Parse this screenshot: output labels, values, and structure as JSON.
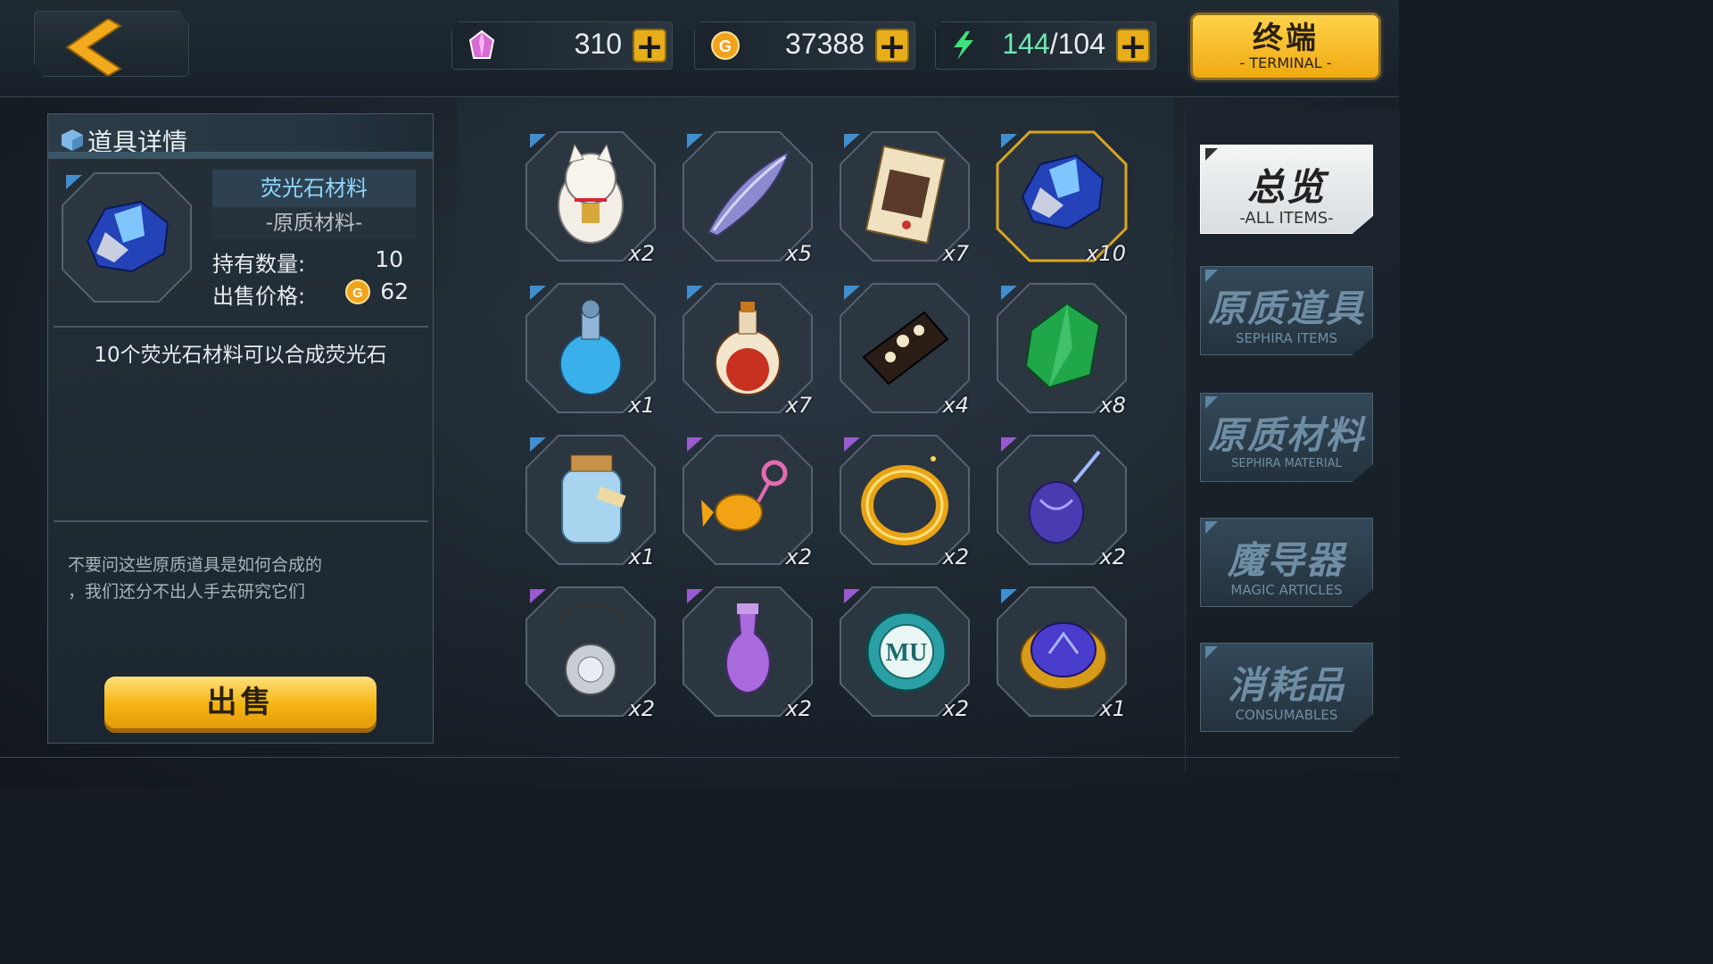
{
  "resources": {
    "crystal": {
      "value": "310"
    },
    "gold": {
      "value": "37388"
    },
    "energy": {
      "current": "144",
      "max": "/104"
    }
  },
  "terminal": {
    "zh": "终端",
    "en": "- TERMINAL -"
  },
  "detail": {
    "title": "道具详情",
    "item_name": "荧光石材料",
    "item_type": "-原质材料-",
    "owned_label": "持有数量:",
    "owned_value": "10",
    "price_label": "出售价格:",
    "price_value": "62",
    "description": "10个荧光石材料可以合成荧光石",
    "flavor": "不要问这些原质道具是如何合成的\n，我们还分不出人手去研究它们",
    "sell_label": "出售"
  },
  "items": [
    {
      "icon": "lucky-cat-icon",
      "qty": "x2",
      "rarity": "blue"
    },
    {
      "icon": "feather-blade-icon",
      "qty": "x5",
      "rarity": "blue"
    },
    {
      "icon": "portrait-card-icon",
      "qty": "x7",
      "rarity": "blue"
    },
    {
      "icon": "fluorite-ore-icon",
      "qty": "x10",
      "rarity": "blue",
      "selected": true
    },
    {
      "icon": "blue-potion-icon",
      "qty": "x1",
      "rarity": "blue"
    },
    {
      "icon": "red-potion-icon",
      "qty": "x7",
      "rarity": "blue"
    },
    {
      "icon": "flower-comb-icon",
      "qty": "x4",
      "rarity": "blue"
    },
    {
      "icon": "green-crystal-icon",
      "qty": "x8",
      "rarity": "blue"
    },
    {
      "icon": "glass-jar-icon",
      "qty": "x1",
      "rarity": "blue"
    },
    {
      "icon": "goldfish-charm-icon",
      "qty": "x2",
      "rarity": "purple"
    },
    {
      "icon": "gold-ring-icon",
      "qty": "x2",
      "rarity": "purple"
    },
    {
      "icon": "purple-pendant-icon",
      "qty": "x2",
      "rarity": "purple"
    },
    {
      "icon": "silver-locket-icon",
      "qty": "x2",
      "rarity": "purple"
    },
    {
      "icon": "purple-vase-icon",
      "qty": "x2",
      "rarity": "purple"
    },
    {
      "icon": "university-badge-icon",
      "qty": "x2",
      "rarity": "purple"
    },
    {
      "icon": "blue-gem-brooch-icon",
      "qty": "x1",
      "rarity": "blue"
    }
  ],
  "tabs": [
    {
      "zh": "总览",
      "en": "-ALL ITEMS-",
      "active": true
    },
    {
      "zh": "原质道具",
      "en": "SEPHIRA ITEMS"
    },
    {
      "zh": "原质材料",
      "en": "SEPHIRA MATERIAL"
    },
    {
      "zh": "魔导器",
      "en": "MAGIC ARTICLES"
    },
    {
      "zh": "消耗品",
      "en": "CONSUMABLES"
    }
  ],
  "colors": {
    "accent": "#f0b020",
    "rarity_blue": "#3f8fd0",
    "rarity_purple": "#9a5ad0",
    "selected_border": "#d9a521"
  }
}
